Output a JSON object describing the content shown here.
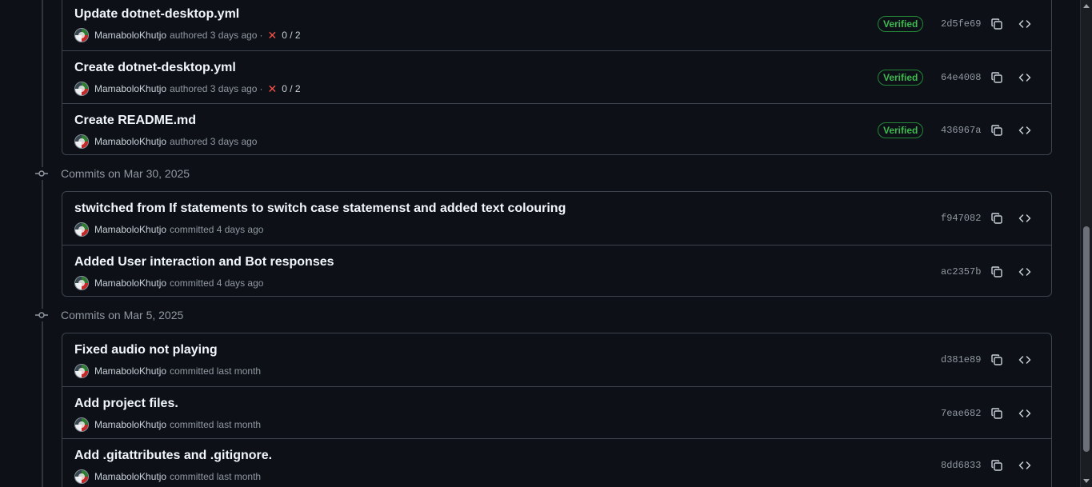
{
  "groups": [
    {
      "header": "",
      "commits": [
        {
          "title": "Update dotnet-desktop.yml",
          "author": "MamaboloKhutjo",
          "action": "authored 3 days ago",
          "separator": "·",
          "checks": "0 / 2",
          "verified": "Verified",
          "sha": "2d5fe69"
        },
        {
          "title": "Create dotnet-desktop.yml",
          "author": "MamaboloKhutjo",
          "action": "authored 3 days ago",
          "separator": "·",
          "checks": "0 / 2",
          "verified": "Verified",
          "sha": "64e4008"
        },
        {
          "title": "Create README.md",
          "author": "MamaboloKhutjo",
          "action": "authored 3 days ago",
          "verified": "Verified",
          "sha": "436967a"
        }
      ]
    },
    {
      "header": "Commits on Mar 30, 2025",
      "commits": [
        {
          "title": "stwitched from If statements to switch case statemenst and added text colouring",
          "author": "MamaboloKhutjo",
          "action": "committed 4 days ago",
          "sha": "f947082"
        },
        {
          "title": "Added User interaction and Bot responses",
          "author": "MamaboloKhutjo",
          "action": "committed 4 days ago",
          "sha": "ac2357b"
        }
      ]
    },
    {
      "header": "Commits on Mar 5, 2025",
      "commits": [
        {
          "title": "Fixed audio not playing",
          "author": "MamaboloKhutjo",
          "action": "committed last month",
          "sha": "d381e89"
        },
        {
          "title": "Add project files.",
          "author": "MamaboloKhutjo",
          "action": "committed last month",
          "sha": "7eae682"
        },
        {
          "title": "Add .gitattributes and .gitignore.",
          "author": "MamaboloKhutjo",
          "action": "committed last month",
          "sha": "8dd6833"
        }
      ]
    }
  ],
  "icons": {
    "copy": "copy-icon",
    "browse": "code-icon",
    "failed": "x-icon",
    "commit": "git-commit-icon",
    "avatar": "avatar-image"
  },
  "colors": {
    "background": "#0d1117",
    "border": "#3d444d",
    "verified": "#3fb950",
    "failed": "#f85149"
  }
}
